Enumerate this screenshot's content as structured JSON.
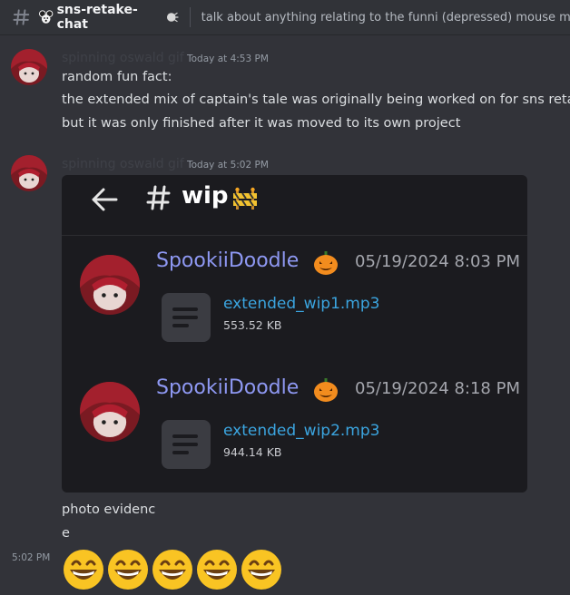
{
  "header": {
    "channel_name": "sns-retake-chat",
    "topic": "talk about anything relating to the funni (depressed) mouse mod"
  },
  "messages": [
    {
      "username": "spinning oswald gif",
      "timestamp": "Today at 4:53 PM",
      "lines": [
        "random fun fact:",
        "the extended mix of captain's tale was originally being worked on for sns retake",
        "but it was only finished after it was moved to its own project"
      ]
    },
    {
      "username": "spinning oswald gif",
      "timestamp": "Today at 5:02 PM",
      "lines": [
        "photo evidenc",
        "e"
      ]
    }
  ],
  "embed": {
    "channel": "wip",
    "posts": [
      {
        "author": "SpookiiDoodle",
        "date": "05/19/2024 8:03 PM",
        "file_name": "extended_wip1.mp3",
        "file_size": "553.52 KB"
      },
      {
        "author": "SpookiiDoodle",
        "date": "05/19/2024 8:18 PM",
        "file_name": "extended_wip2.mp3",
        "file_size": "944.14 KB"
      }
    ]
  },
  "followup": {
    "time": "5:02 PM",
    "emoji": "grinning-face-with-smiling-eyes",
    "emoji_count": 5
  },
  "icons": {
    "channel_hash": "hash-icon",
    "channel_emoji": "mouse-face-icon",
    "author_emoji": "jack-o-lantern-icon",
    "wip_emoji": "construction-barrier-icon"
  }
}
